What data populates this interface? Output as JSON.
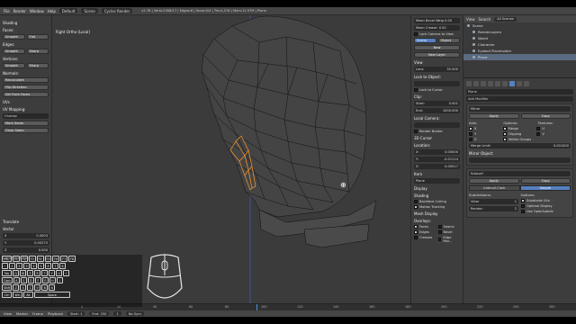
{
  "topbar": {
    "menus": [
      "File",
      "Render",
      "Window",
      "Help"
    ],
    "layout": "Default",
    "scene": "Scene",
    "engine": "Cycles Render",
    "stats": "v2.78 | Verts:2308/17 | Edges:6 | Faces:0/4 | Tris:4,578 | Mem:12.97M | Plane"
  },
  "toolshelf": {
    "shading_head": "Shading",
    "faces_label": "Faces:",
    "smooth": "Smooth",
    "flat": "Flat",
    "edges_label": "Edges:",
    "sharp": "Sharp",
    "vertices_label": "Vertices:",
    "normals_label": "Normals:",
    "recalculate": "Recalculate",
    "flip_direction": "Flip Direction",
    "set_from_faces": "Set From Faces",
    "uvs_head": "UVs",
    "uv_mapping_label": "UV Mapping:",
    "unwrap": "Unwrap",
    "mark_seam": "Mark Seam",
    "clear_seam": "Clear Seam",
    "translate_head": "Translate",
    "vector_label": "Vector",
    "x_label": "X",
    "x_val": "0.0003",
    "y_label": "Y",
    "y_val": "0.00275",
    "z_label": "Z",
    "z_val": "0.000",
    "constraint_label": "Constraint Axis"
  },
  "viewport": {
    "label": "Right Ortho (Local)"
  },
  "npanel": {
    "mean_bevel": "Mean Bevel Weig 0.00",
    "mean_crease": "Mean Crease: 0.00",
    "lock_camera": "Lock Camera to View",
    "scene_tab": "Scene",
    "object_tab": "Object",
    "new_btn": "New",
    "new_layer_btn": "New Layer",
    "view_head": "View",
    "lens_label": "Lens:",
    "lens_val": "35.000",
    "lock_to_object": "Lock to Object:",
    "lock_cursor": "Lock to Cursor",
    "clip_label": "Clip:",
    "start_label": "Start:",
    "start_val": "0.001",
    "end_label": "End:",
    "end_val": "1000.000",
    "local_camera": "Local Camera:",
    "render_border": "Render Border",
    "cursor_head": "3D Cursor",
    "location_label": "Location:",
    "cx_label": "X:",
    "cx_val": "0.00000",
    "cy_label": "Y:",
    "cy_val": "-0.01114",
    "cz_label": "Z:",
    "cz_val": "0.00017",
    "item_head": "Item",
    "item_name": "Plane",
    "display_head": "Display",
    "shading_head": "Shading",
    "backface_culling": "Backface Culling",
    "motion_tracking": "Motion Tracking",
    "mesh_display_head": "Mesh Display",
    "overlays_label": "Overlays:",
    "faces_chk": "Faces",
    "edges_chk": "Edges",
    "creases_chk": "Creases",
    "seams_chk": "Seams",
    "bevel_chk": "Bevel",
    "edge_marks": "Edge Mar..."
  },
  "outliner": {
    "view": "View",
    "search": "Search",
    "all_scenes": "All Scenes",
    "items": [
      {
        "label": "Scene",
        "sel": false
      },
      {
        "label": "RenderLayers",
        "sel": false
      },
      {
        "label": "World",
        "sel": false
      },
      {
        "label": "Character",
        "sel": false
      },
      {
        "label": "Eyeball Placeholder",
        "sel": false
      },
      {
        "label": "Plane",
        "sel": true
      }
    ]
  },
  "props": {
    "object_name": "Plane",
    "add_modifier": "Add Modifier",
    "mirror_name": "Mirror",
    "apply": "Apply",
    "copy": "Copy",
    "axis_label": "Axis:",
    "options_label": "Options:",
    "textures_label": "Textures:",
    "x_axis": "X",
    "y_axis": "Y",
    "z_axis": "Z",
    "merge": "Merge",
    "clipping": "Clipping",
    "vertex_groups": "Vertex Groups",
    "u_label": "U",
    "v_label": "V",
    "merge_limit_label": "Merge Limit:",
    "merge_limit_val": "0.001000",
    "mirror_object_label": "Mirror Object:",
    "subsurf_name": "Subsurf",
    "catmull": "Catmull-Clark",
    "simple": "Simple",
    "subdivisions_label": "Subdivisions:",
    "view_label": "View:",
    "view_val": "1",
    "render_label": "Render:",
    "render_val": "2",
    "subdivide_uvs": "Subdivide UVs",
    "optimal_display": "Optimal Display",
    "use_opensubdiv": "Use OpenSubdiv"
  },
  "timeline": {
    "ticks": [
      "0",
      "20",
      "40",
      "60",
      "80",
      "100",
      "120",
      "140",
      "160",
      "180",
      "200",
      "220",
      "240",
      "260"
    ],
    "view": "View",
    "marker": "Marker",
    "frame": "Frame",
    "playback": "Playback",
    "start_label": "Start:",
    "start_val": "1",
    "end_label": "End:",
    "end_val": "250",
    "current_val": "1",
    "sync": "No Sync"
  },
  "keyboard": {
    "row1": [
      "ESC",
      "F1",
      "F2",
      "F3",
      "F4",
      "F5",
      "F6",
      "F7",
      "F8"
    ],
    "row2": [
      "~",
      "1",
      "2",
      "3",
      "4",
      "5",
      "6",
      "7",
      "8"
    ],
    "row3": [
      "Tab",
      "Q",
      "W",
      "E",
      "R",
      "T",
      "Y",
      "U",
      "I"
    ],
    "row4": [
      "Caps",
      "A",
      "S",
      "D",
      "F",
      "G",
      "H",
      "J"
    ],
    "row5": [
      "Shift",
      "Z",
      "X",
      "C",
      "V",
      "B",
      "N"
    ],
    "row6": [
      "Ctrl",
      "Win",
      "Alt",
      "Space"
    ]
  },
  "colors": {
    "selection_edges": "#ff9a2a",
    "mesh_wire": "#111111",
    "z_axis_line": "#4466cc"
  }
}
